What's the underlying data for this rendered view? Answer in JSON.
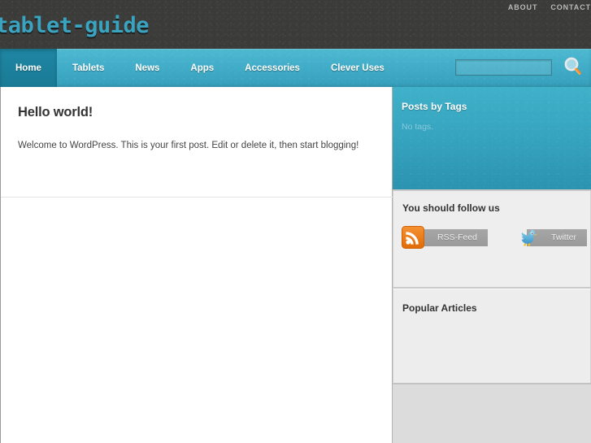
{
  "site": {
    "logo_text": "tablet-guide"
  },
  "top_nav": {
    "items": [
      {
        "label": "ABOUT"
      },
      {
        "label": "CONTACT"
      }
    ]
  },
  "main_nav": {
    "items": [
      {
        "label": "Home",
        "active": true
      },
      {
        "label": "Tablets",
        "active": false
      },
      {
        "label": "News",
        "active": false
      },
      {
        "label": "Apps",
        "active": false
      },
      {
        "label": "Accessories",
        "active": false
      },
      {
        "label": "Clever Uses",
        "active": false
      }
    ]
  },
  "search": {
    "value": "",
    "placeholder": "",
    "button_icon": "magnifier-icon"
  },
  "content": {
    "post": {
      "title": "Hello world!",
      "body": "Welcome to WordPress. This is your first post. Edit or delete it, then start blogging!"
    }
  },
  "sidebar": {
    "widgets": [
      {
        "id": "posts-by-tags",
        "title": "Posts by Tags",
        "empty_text": "No tags."
      },
      {
        "id": "follow-us",
        "title": "You should follow us",
        "buttons": [
          {
            "label": "RSS-Feed",
            "icon": "rss-icon"
          },
          {
            "label": "Twitter",
            "icon": "twitter-bird-icon"
          }
        ]
      },
      {
        "id": "popular-articles",
        "title": "Popular Articles",
        "items": []
      }
    ]
  },
  "colors": {
    "header_bg": "#3b3b3a",
    "nav_teal": "#43aec9",
    "nav_active_teal": "#1a7b96",
    "logo_teal": "#3aa3bf",
    "widget_teal": "#38a6c0",
    "page_bg": "#dcdcdc",
    "rss_orange": "#ea7317",
    "twitter_blue": "#4fa9d6"
  }
}
